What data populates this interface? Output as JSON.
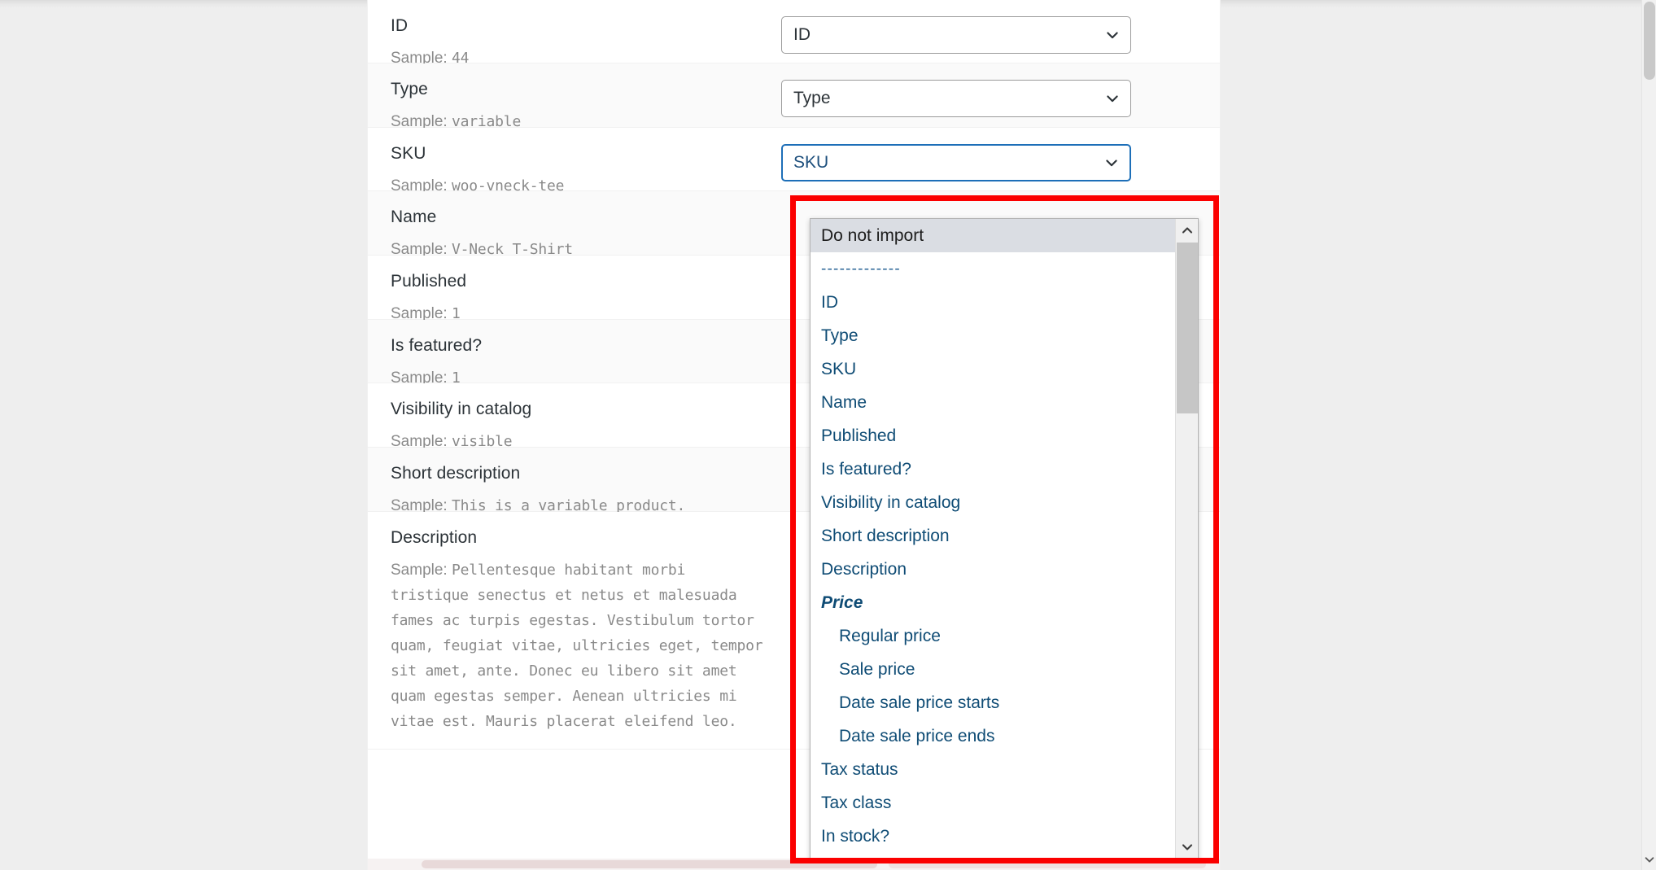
{
  "mapping_rows": [
    {
      "column": "ID",
      "sample_prefix": "Sample: ",
      "sample": "44",
      "select_value": "ID",
      "state": "normal"
    },
    {
      "column": "Type",
      "sample_prefix": "Sample: ",
      "sample": "variable",
      "select_value": "Type",
      "state": "normal"
    },
    {
      "column": "SKU",
      "sample_prefix": "Sample: ",
      "sample": "woo-vneck-tee",
      "select_value": "SKU",
      "state": "focused"
    },
    {
      "column": "Name",
      "sample_prefix": "Sample: ",
      "sample": "V-Neck T-Shirt",
      "select_value": "",
      "state": "hidden"
    },
    {
      "column": "Published",
      "sample_prefix": "Sample: ",
      "sample": "1",
      "select_value": "",
      "state": "hidden"
    },
    {
      "column": "Is featured?",
      "sample_prefix": "Sample: ",
      "sample": "1",
      "select_value": "",
      "state": "hidden"
    },
    {
      "column": "Visibility in catalog",
      "sample_prefix": "Sample: ",
      "sample": "visible",
      "select_value": "",
      "state": "hidden"
    },
    {
      "column": "Short description",
      "sample_prefix": "Sample: ",
      "sample": "This is a variable product.",
      "select_value": "",
      "state": "hidden"
    },
    {
      "column": "Description",
      "sample_prefix": "Sample: ",
      "sample": "Pellentesque habitant morbi tristique senectus et netus et malesuada fames ac turpis egestas. Vestibulum tortor quam, feugiat vitae, ultricies eget, tempor sit amet, ante. Donec eu libero sit amet quam egestas semper. Aenean ultricies mi vitae est. Mauris placerat eleifend leo.",
      "select_value": "",
      "state": "hidden"
    }
  ],
  "dropdown": {
    "options": [
      {
        "label": "Do not import",
        "type": "option",
        "selected": true,
        "indented": false
      },
      {
        "label": "-------------",
        "type": "separator",
        "selected": false,
        "indented": false
      },
      {
        "label": "ID",
        "type": "option",
        "selected": false,
        "indented": false
      },
      {
        "label": "Type",
        "type": "option",
        "selected": false,
        "indented": false
      },
      {
        "label": "SKU",
        "type": "option",
        "selected": false,
        "indented": false
      },
      {
        "label": "Name",
        "type": "option",
        "selected": false,
        "indented": false
      },
      {
        "label": "Published",
        "type": "option",
        "selected": false,
        "indented": false
      },
      {
        "label": "Is featured?",
        "type": "option",
        "selected": false,
        "indented": false
      },
      {
        "label": "Visibility in catalog",
        "type": "option",
        "selected": false,
        "indented": false
      },
      {
        "label": "Short description",
        "type": "option",
        "selected": false,
        "indented": false
      },
      {
        "label": "Description",
        "type": "option",
        "selected": false,
        "indented": false
      },
      {
        "label": "Price",
        "type": "group",
        "selected": false,
        "indented": false
      },
      {
        "label": "Regular price",
        "type": "option",
        "selected": false,
        "indented": true
      },
      {
        "label": "Sale price",
        "type": "option",
        "selected": false,
        "indented": true
      },
      {
        "label": "Date sale price starts",
        "type": "option",
        "selected": false,
        "indented": true
      },
      {
        "label": "Date sale price ends",
        "type": "option",
        "selected": false,
        "indented": true
      },
      {
        "label": "Tax status",
        "type": "option",
        "selected": false,
        "indented": false
      },
      {
        "label": "Tax class",
        "type": "option",
        "selected": false,
        "indented": false
      },
      {
        "label": "In stock?",
        "type": "option",
        "selected": false,
        "indented": false
      }
    ],
    "scroll_up_icon": "chevron-up-icon",
    "scroll_down_icon": "chevron-down-icon"
  },
  "icons": {
    "select_caret": "chevron-down-icon",
    "page_scroll_down": "chevron-down-icon"
  },
  "colors": {
    "annotation": "#fb0000",
    "focus_border": "#1d6fb8",
    "option_text": "#0f4c75",
    "selected_bg": "#dadde3",
    "panel_bg": "#ffffff",
    "page_bg": "#eeeeee"
  }
}
